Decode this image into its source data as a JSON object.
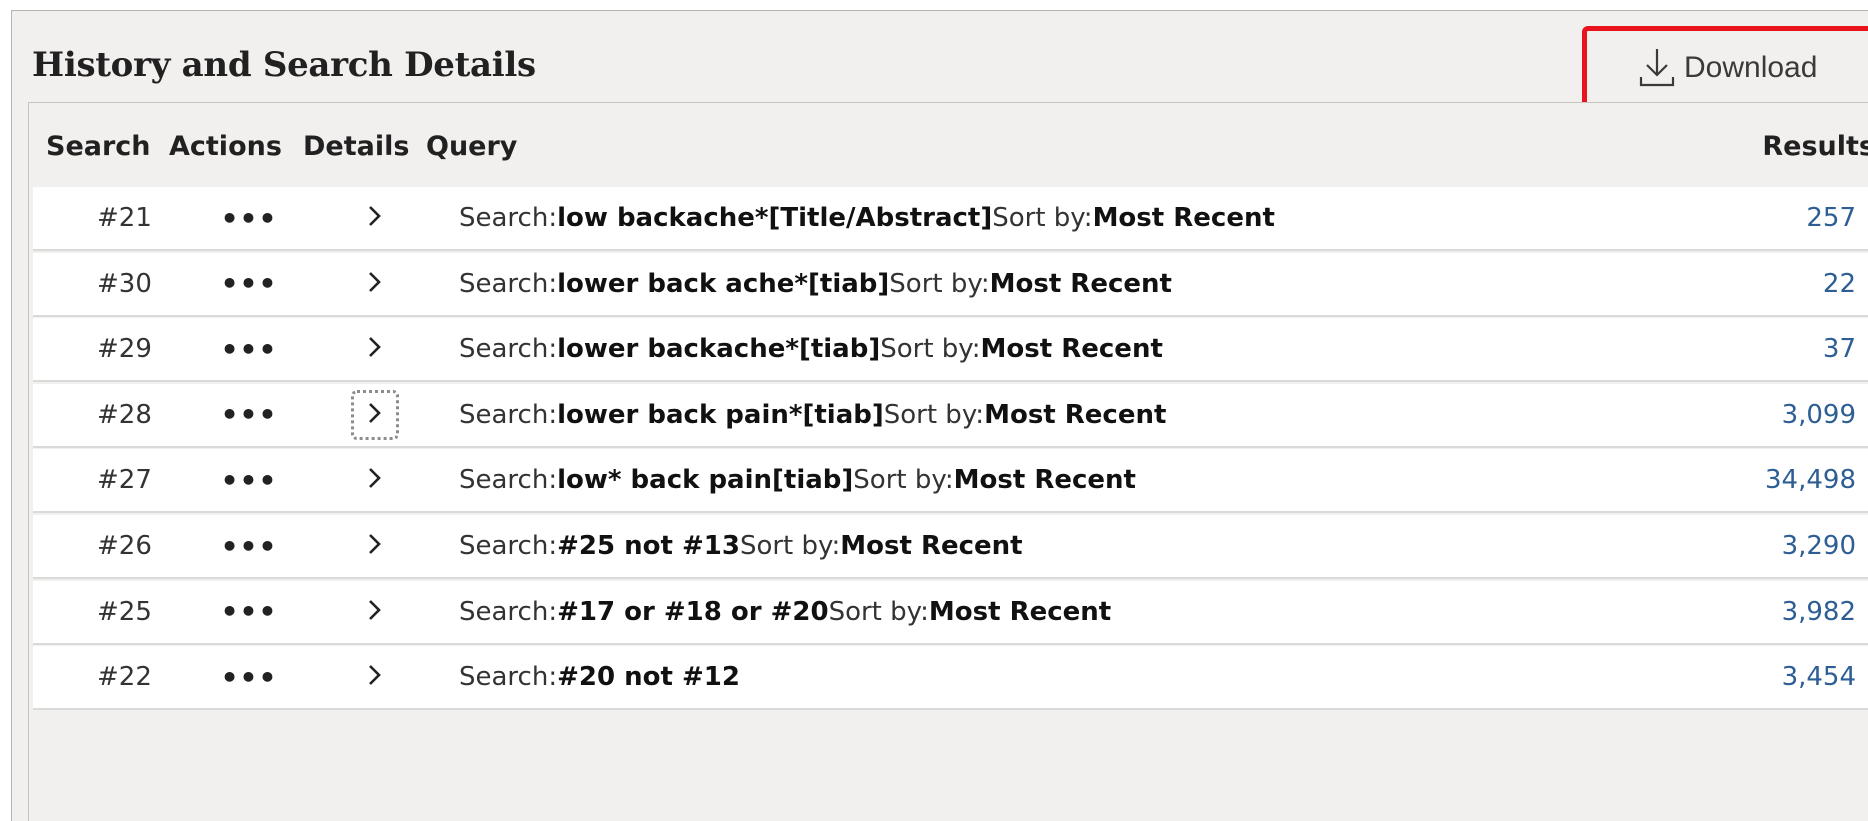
{
  "panel": {
    "title": "History and Search Details",
    "download_label": "Download"
  },
  "table": {
    "headers": {
      "search": "Search",
      "actions": "Actions",
      "details": "Details",
      "query": "Query",
      "results": "Results"
    },
    "rows": [
      {
        "num": "#21",
        "actions": "•••",
        "q_prefix": "Search: ",
        "q_term": "low backache*[Title/Abstract]",
        "q_sort_label": " Sort by: ",
        "q_sort": "Most Recent",
        "results": "257",
        "focused": false
      },
      {
        "num": "#30",
        "actions": "•••",
        "q_prefix": "Search: ",
        "q_term": "lower back ache*[tiab]",
        "q_sort_label": " Sort by: ",
        "q_sort": "Most Recent",
        "results": "22",
        "focused": false
      },
      {
        "num": "#29",
        "actions": "•••",
        "q_prefix": "Search: ",
        "q_term": "lower backache*[tiab]",
        "q_sort_label": " Sort by: ",
        "q_sort": "Most Recent",
        "results": "37",
        "focused": false
      },
      {
        "num": "#28",
        "actions": "•••",
        "q_prefix": "Search: ",
        "q_term": "lower back pain*[tiab]",
        "q_sort_label": " Sort by: ",
        "q_sort": "Most Recent",
        "results": "3,099",
        "focused": true
      },
      {
        "num": "#27",
        "actions": "•••",
        "q_prefix": "Search: ",
        "q_term": "low* back pain[tiab]",
        "q_sort_label": " Sort by: ",
        "q_sort": "Most Recent",
        "results": "34,498",
        "focused": false
      },
      {
        "num": "#26",
        "actions": "•••",
        "q_prefix": "Search: ",
        "q_term": "#25 not #13",
        "q_sort_label": " Sort by: ",
        "q_sort": "Most Recent",
        "results": "3,290",
        "focused": false
      },
      {
        "num": "#25",
        "actions": "•••",
        "q_prefix": "Search: ",
        "q_term": "#17 or #18 or #20",
        "q_sort_label": " Sort by: ",
        "q_sort": "Most Recent",
        "results": "3,982",
        "focused": false
      },
      {
        "num": "#22",
        "actions": "•••",
        "q_prefix": "Search: ",
        "q_term": "#20 not #12",
        "q_sort_label": "",
        "q_sort": "",
        "results": "3,454",
        "focused": false
      }
    ]
  },
  "colors": {
    "panel_bg": "#f2f0ee",
    "highlight_border": "#e8131c",
    "results_link": "#2d5e94"
  },
  "icons": {
    "download": "download-icon",
    "details": "chevron-right-icon",
    "actions": "more-horizontal-icon"
  }
}
